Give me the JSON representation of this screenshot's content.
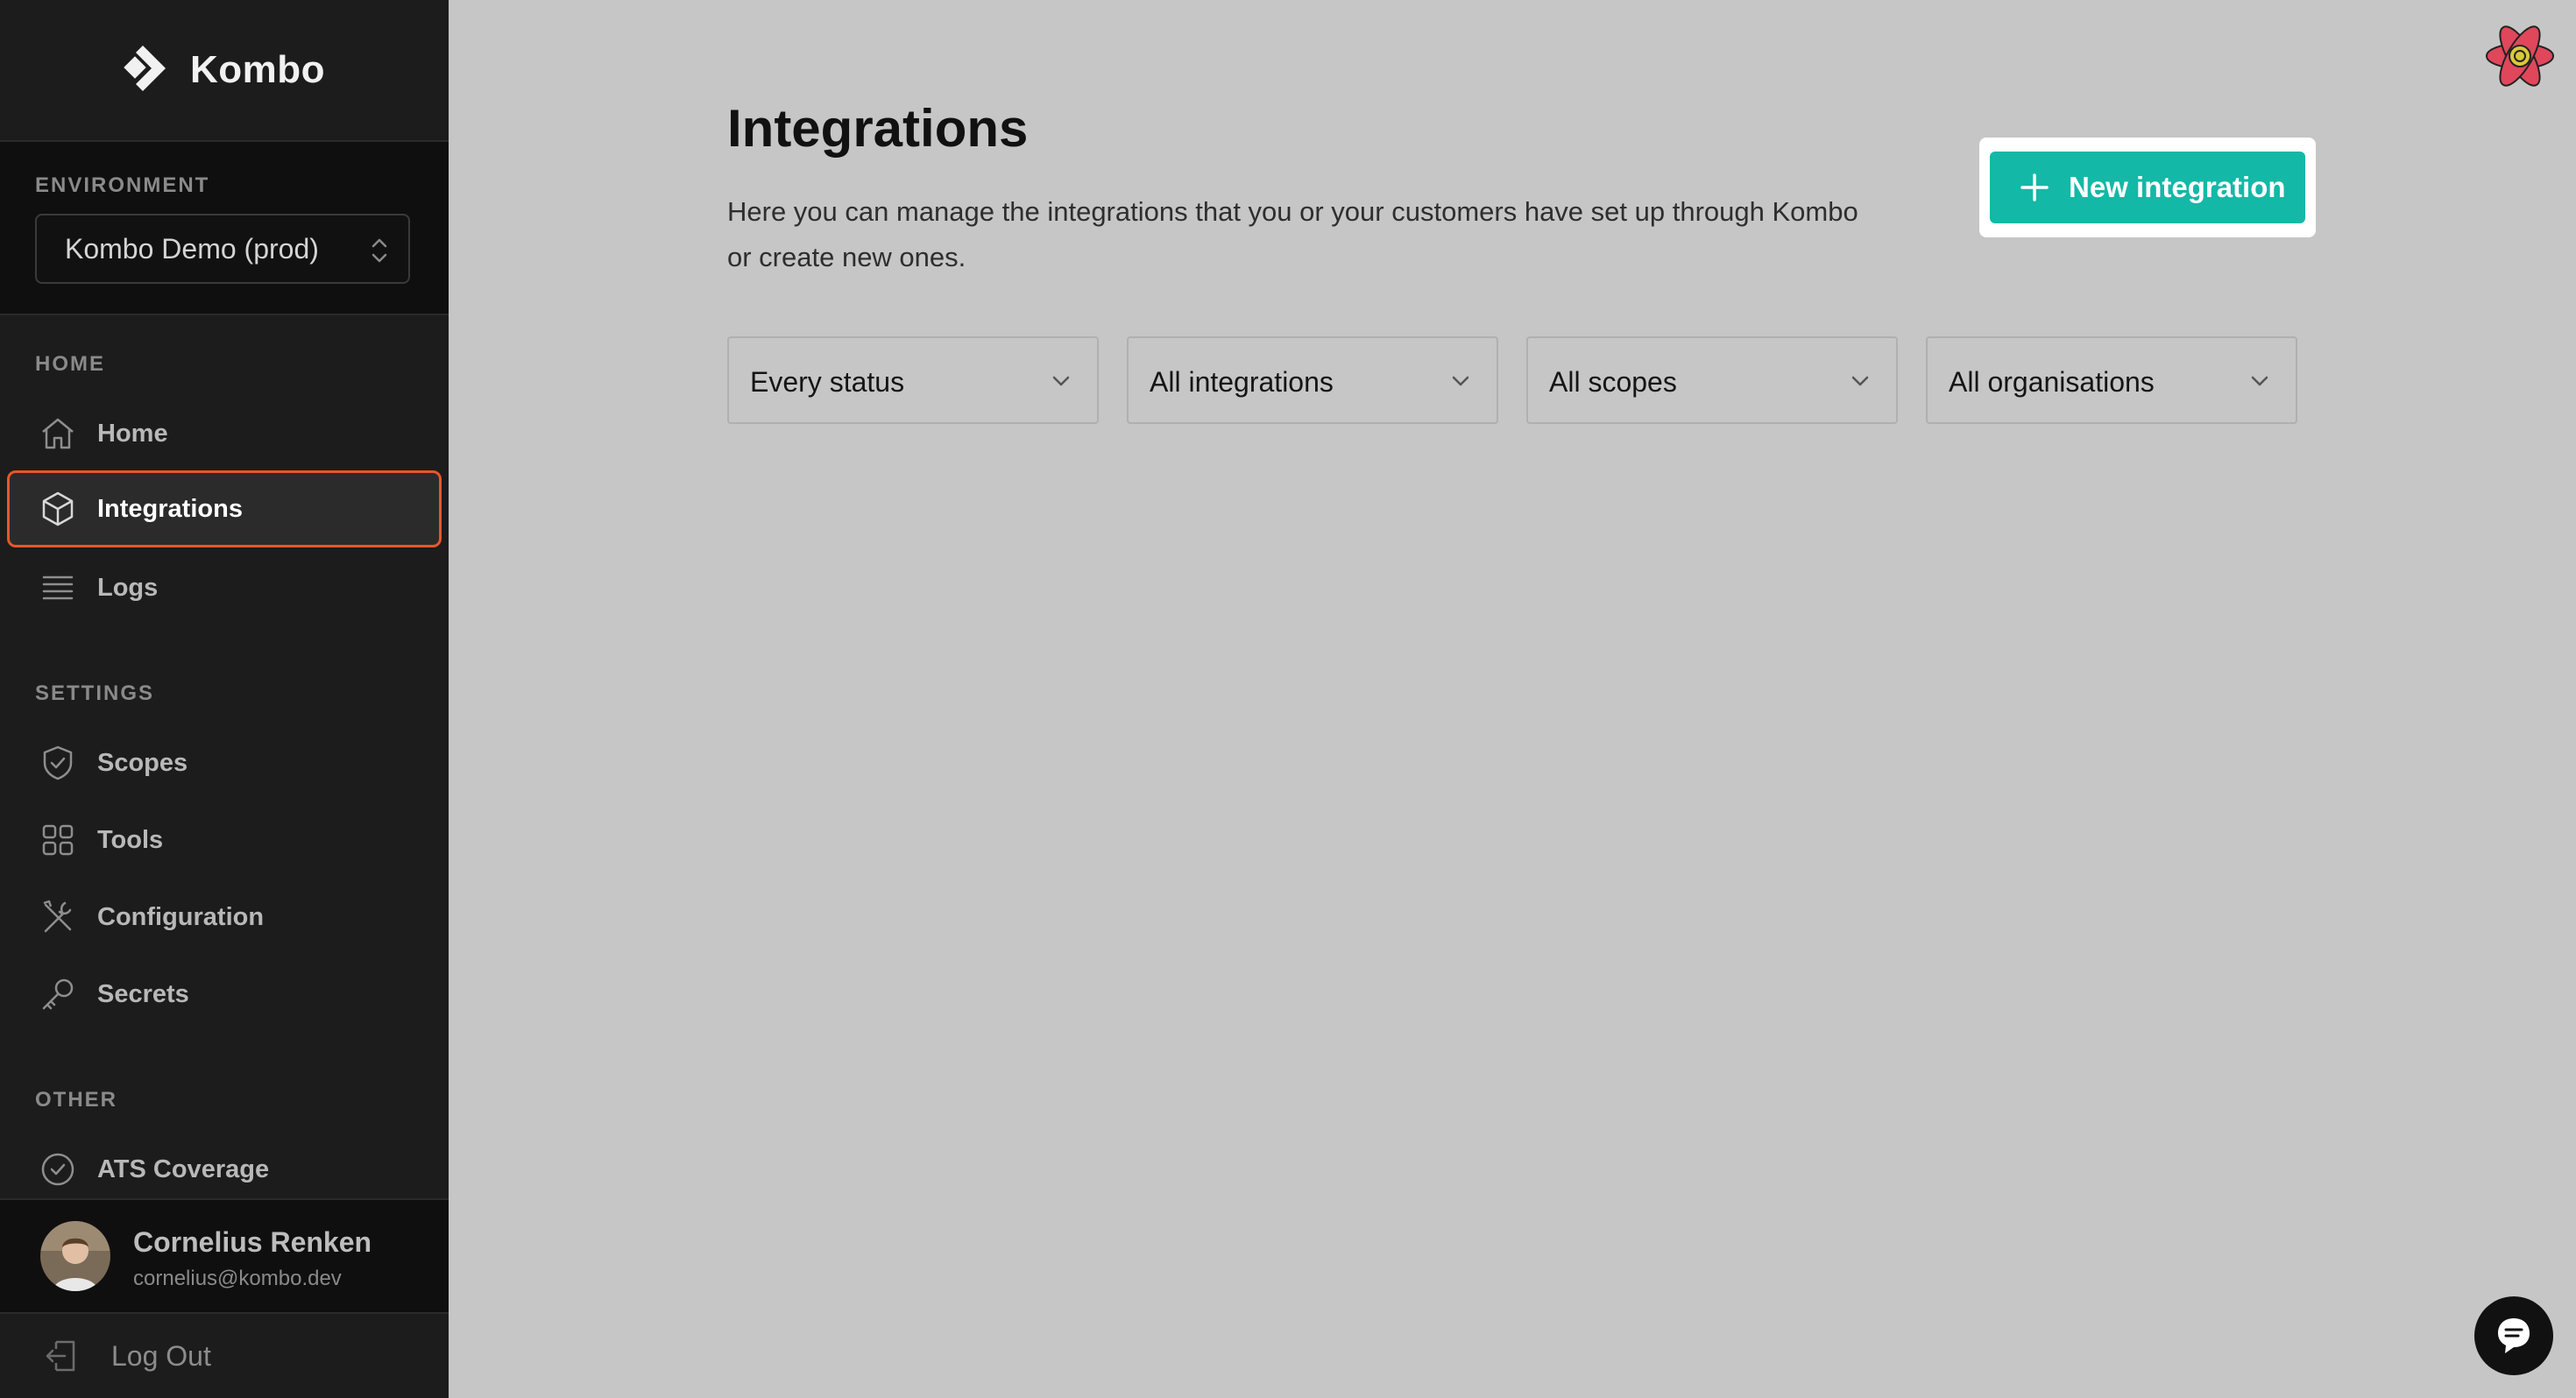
{
  "brand": {
    "name": "Kombo",
    "icon": "kombo-logo-icon"
  },
  "environment": {
    "section_label": "ENVIRONMENT",
    "selected": "Kombo Demo (prod)"
  },
  "sidebar": {
    "sections": [
      {
        "label": "HOME"
      },
      {
        "label": "SETTINGS"
      },
      {
        "label": "OTHER"
      }
    ],
    "items": [
      {
        "label": "Home",
        "icon": "home-icon"
      },
      {
        "label": "Integrations",
        "icon": "cube-icon",
        "active": true
      },
      {
        "label": "Logs",
        "icon": "list-icon"
      },
      {
        "label": "Scopes",
        "icon": "shield-check-icon"
      },
      {
        "label": "Tools",
        "icon": "grid-icon"
      },
      {
        "label": "Configuration",
        "icon": "wrench-screwdriver-icon"
      },
      {
        "label": "Secrets",
        "icon": "key-icon"
      },
      {
        "label": "ATS Coverage",
        "icon": "check-circle-icon"
      }
    ]
  },
  "user": {
    "name": "Cornelius Renken",
    "email": "cornelius@kombo.dev",
    "logout_label": "Log Out"
  },
  "main": {
    "title": "Integrations",
    "description": "Here you can manage the integrations that you or your customers have set up through Kombo or create new ones.",
    "new_button_label": "New integration",
    "filters": [
      {
        "value": "Every status"
      },
      {
        "value": "All integrations"
      },
      {
        "value": "All scopes"
      },
      {
        "value": "All organisations"
      }
    ]
  },
  "colors": {
    "accent": "#14b8a6",
    "sidebar_bg": "#1c1c1c",
    "active_outline": "#e8562c",
    "page_bg": "#c6c6c6"
  }
}
